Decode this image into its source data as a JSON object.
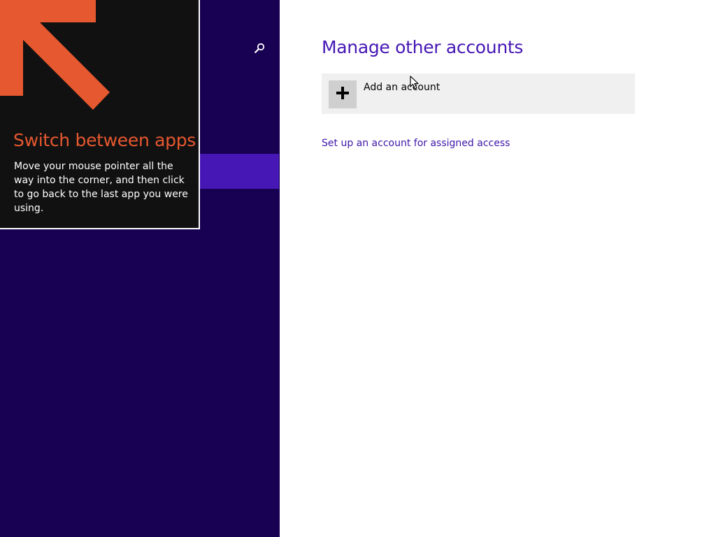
{
  "tip": {
    "title": "Switch between apps",
    "body": "Move your mouse pointer all the way into the corner, and then click to go back to the last app you were using.",
    "arrow_icon": "arrow-up-left-icon",
    "accent_color": "#e6582f"
  },
  "left_pane": {
    "search_icon": "search-icon",
    "background_color": "#180052",
    "selected_color": "#4617b4"
  },
  "main": {
    "title": "Manage other accounts",
    "add_account": {
      "label": "Add an account",
      "icon": "plus-icon"
    },
    "assigned_access_link": "Set up an account for assigned access",
    "accent_color": "#4617b4"
  }
}
